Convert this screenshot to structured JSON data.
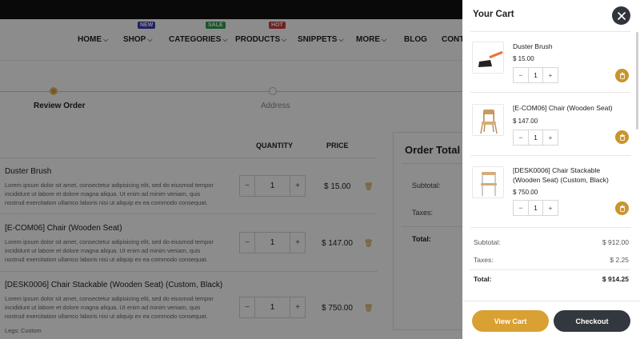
{
  "nav": {
    "items": [
      {
        "label": "HOME",
        "has_chevron": true
      },
      {
        "label": "SHOP",
        "has_chevron": true,
        "badge": "NEW",
        "badge_color": "#3b3bb8"
      },
      {
        "label": "CATEGORIES",
        "has_chevron": true,
        "badge": "SALE",
        "badge_color": "#2a9d4e"
      },
      {
        "label": "PRODUCTS",
        "has_chevron": true,
        "badge": "HOT",
        "badge_color": "#d23b3b"
      },
      {
        "label": "SNIPPETS",
        "has_chevron": true
      },
      {
        "label": "MORE",
        "has_chevron": true
      },
      {
        "label": "BLOG",
        "has_chevron": false
      },
      {
        "label": "CONTA",
        "has_chevron": false
      }
    ]
  },
  "wizard": {
    "steps": [
      {
        "label": "Review Order",
        "active": true
      },
      {
        "label": "Address",
        "active": false
      }
    ]
  },
  "table": {
    "headers": {
      "quantity": "QUANTITY",
      "price": "PRICE"
    },
    "rows": [
      {
        "name": "Duster Brush",
        "desc": "Lorem ipsum dolor sit amet, consectetur adipisicing elit, sed do eiusmod tempor incididunt ut labore et dolore magna aliqua. Ut enim ad minim veniam, quis nostrud exercitation ullamco laboris nisi ut aliquip ex ea commodo consequat.",
        "qty": "1",
        "price": "$ 15.00"
      },
      {
        "name": "[E-COM06] Chair (Wooden Seat)",
        "desc": "Lorem ipsum dolor sit amet, consectetur adipisicing elit, sed do eiusmod tempor incididunt ut labore et dolore magna aliqua. Ut enim ad minim veniam, quis nostrud exercitation ullamco laboris nisi ut aliquip ex ea commodo consequat.",
        "qty": "1",
        "price": "$ 147.00"
      },
      {
        "name": "[DESK0006] Chair Stackable (Wooden Seat) (Custom, Black)",
        "desc": "Lorem ipsum dolor sit amet, consectetur adipisicing elit, sed do eiusmod tempor incididunt ut labore et dolore magna aliqua. Ut enim ad minim veniam, quis nostrud exercitation ullamco laboris nisi ut aliquip ex ea commodo consequat.",
        "qty": "1",
        "price": "$ 750.00"
      }
    ],
    "extra_note": "Legs: Custom"
  },
  "order_summary": {
    "title": "Order Total",
    "subtotal_label": "Subtotal:",
    "taxes_label": "Taxes:",
    "total_label": "Total:"
  },
  "cart": {
    "title": "Your Cart",
    "items": [
      {
        "name": "Duster Brush",
        "price": "$ 15.00",
        "qty": "1",
        "icon": "brush-icon"
      },
      {
        "name": "[E-COM06] Chair (Wooden Seat)",
        "price": "$ 147.00",
        "qty": "1",
        "icon": "chair-icon"
      },
      {
        "name": "[DESK0006] Chair Stackable (Wooden Seat) (Custom, Black)",
        "price": "$ 750.00",
        "qty": "1",
        "icon": "stackable-chair-icon"
      }
    ],
    "subtotal_label": "Subtotal:",
    "subtotal_value": "$ 912.00",
    "taxes_label": "Taxes:",
    "taxes_value": "$ 2.25",
    "total_label": "Total:",
    "total_value": "$ 914.25",
    "view_cart_label": "View Cart",
    "checkout_label": "Checkout"
  },
  "colors": {
    "accent": "#d9a033",
    "dark": "#33383e",
    "overlay": "rgba(0,0,0,0.45)"
  }
}
